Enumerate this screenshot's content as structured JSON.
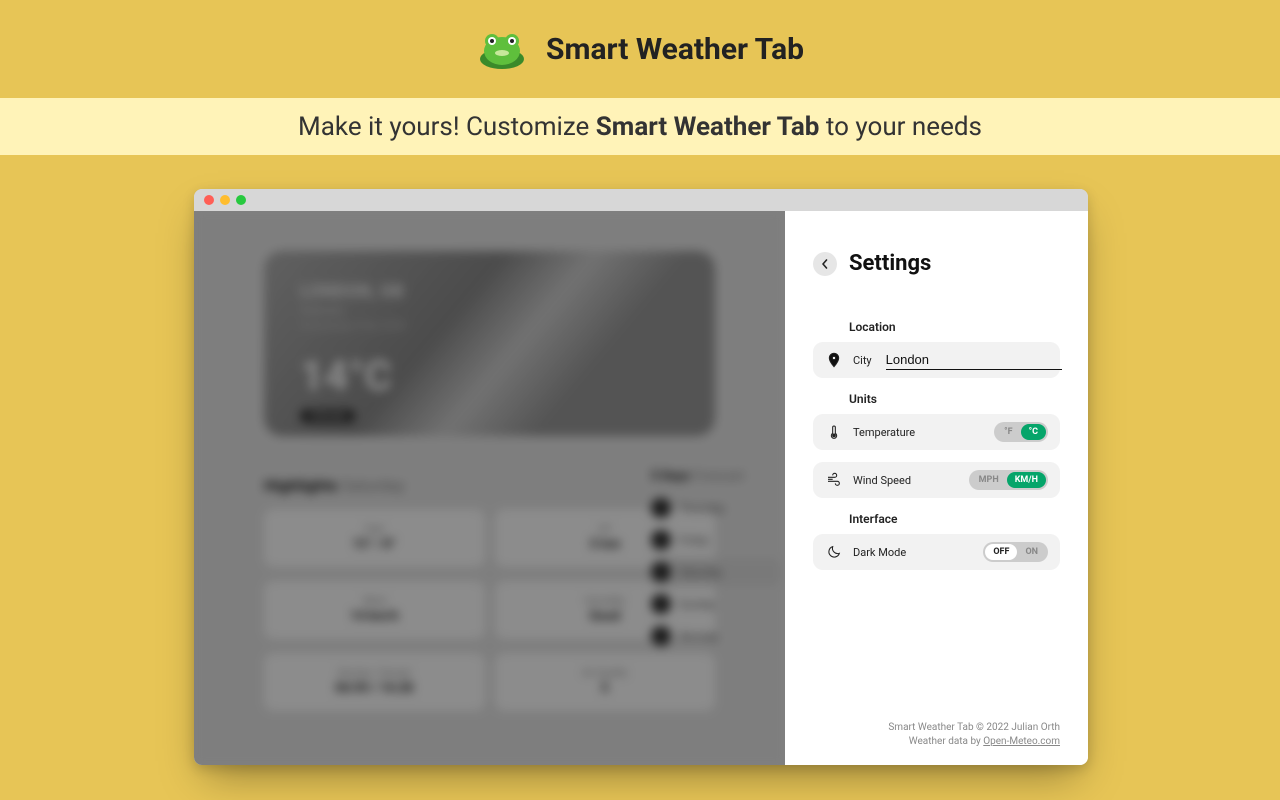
{
  "header": {
    "title": "Smart Weather Tab"
  },
  "subheader": {
    "prefix": "Make it yours! Customize ",
    "bold": "Smart Weather Tab",
    "suffix": " to your needs"
  },
  "blurred": {
    "city_upper": "LONDON, GB",
    "sub": "Overcast",
    "date": "Wednesday, 4 Dec 2024",
    "temp": "14°C",
    "badge": "Overcast",
    "highlights_title": "Highlights",
    "highlights_day": "Saturday",
    "tiles": [
      {
        "k": "Feel",
        "v": "13° / 8°"
      },
      {
        "k": "UV",
        "v": "3 low"
      },
      {
        "k": "Wind",
        "v": "14 km/h"
      },
      {
        "k": "Humidity",
        "v": "Good"
      },
      {
        "k": "Sunrise / Sunset",
        "v": "06:59 / 16:28"
      },
      {
        "k": "Air Quality",
        "v": "5"
      }
    ],
    "forecast_title": "5 Days",
    "forecast_sub": "Forecast",
    "forecast": [
      "Thursday",
      "Friday",
      "Saturday",
      "Sunday",
      "Monday"
    ],
    "forecast_active": 2
  },
  "settings": {
    "title": "Settings",
    "location": {
      "section": "Location",
      "city_label": "City",
      "city_value": "London"
    },
    "units": {
      "section": "Units",
      "temperature": {
        "label": "Temperature",
        "left": "°F",
        "right": "°C",
        "active": "right"
      },
      "wind": {
        "label": "Wind Speed",
        "left": "MPH",
        "right": "KM/H",
        "active": "right"
      }
    },
    "interface": {
      "section": "Interface",
      "dark_mode": {
        "label": "Dark Mode",
        "left": "OFF",
        "right": "ON",
        "active": "left"
      }
    }
  },
  "footer": {
    "line1": "Smart Weather Tab © 2022 Julian Orth",
    "line2_prefix": "Weather data by ",
    "line2_link": "Open-Meteo.com"
  }
}
